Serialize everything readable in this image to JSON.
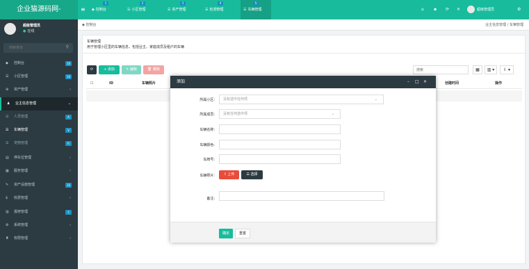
{
  "app": {
    "title": "企业猫源码网-"
  },
  "topbar": {
    "tabs": [
      {
        "icon": "tachometer-icon",
        "glyph": "◆",
        "label": "控制台",
        "badge": "1"
      },
      {
        "icon": "list-icon",
        "glyph": "☰",
        "label": "小区管理",
        "badge": "2"
      },
      {
        "icon": "list-icon",
        "glyph": "☰",
        "label": "资产管理",
        "badge": "3"
      },
      {
        "icon": "list-icon",
        "glyph": "☰",
        "label": "检测管理",
        "badge": "4"
      },
      {
        "icon": "list-icon",
        "glyph": "☰",
        "label": "车辆管理",
        "badge": "5"
      }
    ],
    "admin_name": "超级管理员"
  },
  "sidebar": {
    "user_name": "超级管理员",
    "user_status": "在线",
    "search_placeholder": "搜索菜单",
    "items": [
      {
        "label": "控制台",
        "glyph": "◆",
        "badge": "10",
        "badge_color": "#1a8fc1"
      },
      {
        "label": "小区管理",
        "glyph": "☰",
        "badge": "10",
        "badge_color": "#1a8fc1"
      },
      {
        "label": "资产管理",
        "glyph": "⊕",
        "arrow": "‹"
      },
      {
        "label": "业主信息管理",
        "glyph": "♟",
        "arrow": "⌄"
      },
      {
        "label": "人员管理",
        "glyph": "☰",
        "badge": "A",
        "badge_color": "#1a8fc1"
      },
      {
        "label": "车辆管理",
        "glyph": "☰",
        "badge": "V",
        "badge_color": "#1a8fc1"
      },
      {
        "label": "宠物管理",
        "glyph": "☰",
        "badge": "R",
        "badge_color": "#1a8fc1"
      },
      {
        "label": "停车位管理",
        "glyph": "▤",
        "arrow": "‹"
      },
      {
        "label": "服务管理",
        "glyph": "▦",
        "arrow": "‹"
      },
      {
        "label": "资产设施管理",
        "glyph": "✎",
        "badge": "10",
        "badge_color": "#1a8fc1"
      },
      {
        "label": "收费管理",
        "glyph": "$",
        "arrow": "‹"
      },
      {
        "label": "报修管理",
        "glyph": "▥",
        "badge": "5",
        "badge_color": "#1a8fc1"
      },
      {
        "label": "系统管理",
        "glyph": "⚙",
        "arrow": "‹"
      },
      {
        "label": "权限管理",
        "glyph": "♜",
        "arrow": "‹"
      }
    ]
  },
  "breadcrumb": {
    "home": "控制台",
    "right": "业主信息管理 / 车辆管理"
  },
  "panel": {
    "title": "车辆管理",
    "desc": "用于管理小区里的车辆信息，包括业主、家庭成员及租户的车辆"
  },
  "toolbar": {
    "refresh": "⟳",
    "add": "+ 添加",
    "edit": "✎ 编辑",
    "delete": "🗑 删除",
    "search_placeholder": "搜索",
    "view_icon": "▦",
    "columns_icon": "▥ ▾",
    "export_icon": "⇩ ▾"
  },
  "table": {
    "columns": [
      "ID",
      "车辆照片",
      "创建时间",
      "操作"
    ]
  },
  "modal": {
    "title": "添加",
    "controls": [
      "–",
      "□",
      "×"
    ],
    "fields": [
      {
        "label": "所属小区:",
        "placeholder": "没有选中任何项",
        "type": "select"
      },
      {
        "label": "所属成员:",
        "placeholder": "没有任何选中项",
        "type": "select"
      },
      {
        "label": "车辆名称:",
        "value": "",
        "type": "text"
      },
      {
        "label": "车辆颜色:",
        "value": "",
        "type": "text"
      },
      {
        "label": "车牌号:",
        "value": "",
        "type": "text"
      },
      {
        "label": "车辆照片:",
        "type": "upload"
      },
      {
        "label": "备注:",
        "value": "",
        "type": "text"
      }
    ],
    "upload_label": "⇧ 上传",
    "choose_label": "☰ 选择",
    "ok_label": "确定",
    "reset_label": "重置"
  }
}
